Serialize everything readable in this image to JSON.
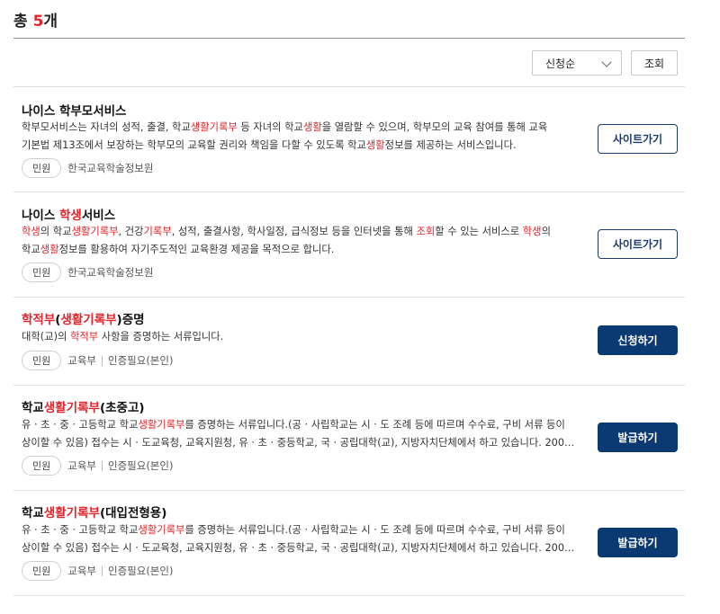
{
  "header": {
    "total_prefix": "총 ",
    "total_count": "5",
    "total_suffix": "개"
  },
  "controls": {
    "sort_selected": "신청순",
    "search_label": "조회"
  },
  "colors": {
    "highlight": "#e0242b",
    "primary_button": "#0b3a73"
  },
  "items": [
    {
      "title": [
        {
          "t": "나이스 학부모서비스",
          "h": false
        }
      ],
      "lines": [
        [
          {
            "t": "학부모서비스는 자녀의 성적, 출결, 학교",
            "h": false
          },
          {
            "t": "생활기록부",
            "h": true
          },
          {
            "t": " 등 자녀의 학교",
            "h": false
          },
          {
            "t": "생활",
            "h": true
          },
          {
            "t": "을 열람할 수 있으며, 학부모의 교육 참여를 통해 교육",
            "h": false
          }
        ],
        [
          {
            "t": "기본법 제13조에서 보장하는 학부모의 교육할 권리와 책임을 다할 수 있도록 학교",
            "h": false
          },
          {
            "t": "생활",
            "h": true
          },
          {
            "t": "정보를 제공하는 서비스입니다.",
            "h": false
          }
        ]
      ],
      "tag": "민원",
      "org": "한국교육학술정보원",
      "auth": "",
      "button": "사이트가기",
      "button_style": "outline"
    },
    {
      "title": [
        {
          "t": "나이스 ",
          "h": false
        },
        {
          "t": "학생",
          "h": true
        },
        {
          "t": "서비스",
          "h": false
        }
      ],
      "lines": [
        [
          {
            "t": "학생",
            "h": true
          },
          {
            "t": "의 학교",
            "h": false
          },
          {
            "t": "생활기록부",
            "h": true
          },
          {
            "t": ", 건강",
            "h": false
          },
          {
            "t": "기록부",
            "h": true
          },
          {
            "t": ", 성적, 출결사항, 학사일정, 급식정보 등을 인터넷을 통해 ",
            "h": false
          },
          {
            "t": "조회",
            "h": true
          },
          {
            "t": "할 수 있는 서비스로 ",
            "h": false
          },
          {
            "t": "학생",
            "h": true
          },
          {
            "t": "의",
            "h": false
          }
        ],
        [
          {
            "t": "학교",
            "h": false
          },
          {
            "t": "생활",
            "h": true
          },
          {
            "t": "정보를 활용하여 자기주도적인 교육환경 제공을 목적으로 합니다.",
            "h": false
          }
        ]
      ],
      "tag": "민원",
      "org": "한국교육학술정보원",
      "auth": "",
      "button": "사이트가기",
      "button_style": "outline"
    },
    {
      "title": [
        {
          "t": "학적부",
          "h": true
        },
        {
          "t": "(",
          "h": false
        },
        {
          "t": "생활기록부",
          "h": true
        },
        {
          "t": ")증명",
          "h": false
        }
      ],
      "lines": [
        [
          {
            "t": "대학(교)의 ",
            "h": false
          },
          {
            "t": "학적부",
            "h": true
          },
          {
            "t": " 사항을 증명하는 서류입니다.",
            "h": false
          }
        ]
      ],
      "tag": "민원",
      "org": "교육부",
      "auth": "인증필요(본인)",
      "button": "신청하기",
      "button_style": "fill"
    },
    {
      "title": [
        {
          "t": "학교",
          "h": false
        },
        {
          "t": "생활기록부",
          "h": true
        },
        {
          "t": "(초중고)",
          "h": false
        }
      ],
      "lines": [
        [
          {
            "t": "유 · 초 · 중 · 고등학교 학교",
            "h": false
          },
          {
            "t": "생활기록부",
            "h": true
          },
          {
            "t": "를 증명하는 서류입니다.(공 · 사립학교는 시 · 도 조례 등에 따르며 수수료, 구비 서류 등이",
            "h": false
          }
        ],
        [
          {
            "t": "상이할 수 있음) 접수는 시 · 도교육청, 교육지원청, 유 · 초 · 중등학교, 국 · 공립대학(교), 지방자치단체에서 하고 있습니다. 200…",
            "h": false
          }
        ]
      ],
      "tag": "민원",
      "org": "교육부",
      "auth": "인증필요(본인)",
      "button": "발급하기",
      "button_style": "fill"
    },
    {
      "title": [
        {
          "t": "학교",
          "h": false
        },
        {
          "t": "생활기록부",
          "h": true
        },
        {
          "t": "(대입전형용)",
          "h": false
        }
      ],
      "lines": [
        [
          {
            "t": "유 · 초 · 중 · 고등학교 학교",
            "h": false
          },
          {
            "t": "생활기록부",
            "h": true
          },
          {
            "t": "를 증명하는 서류입니다.(공 · 사립학교는 시 · 도 조례 등에 따르며 수수료, 구비 서류 등이",
            "h": false
          }
        ],
        [
          {
            "t": "상이할 수 있음) 접수는 시 · 도교육청, 교육지원청, 유 · 초 · 중등학교, 국 · 공립대학(교), 지방자치단체에서 하고 있습니다. 200…",
            "h": false
          }
        ]
      ],
      "tag": "민원",
      "org": "교육부",
      "auth": "인증필요(본인)",
      "button": "발급하기",
      "button_style": "fill"
    }
  ]
}
